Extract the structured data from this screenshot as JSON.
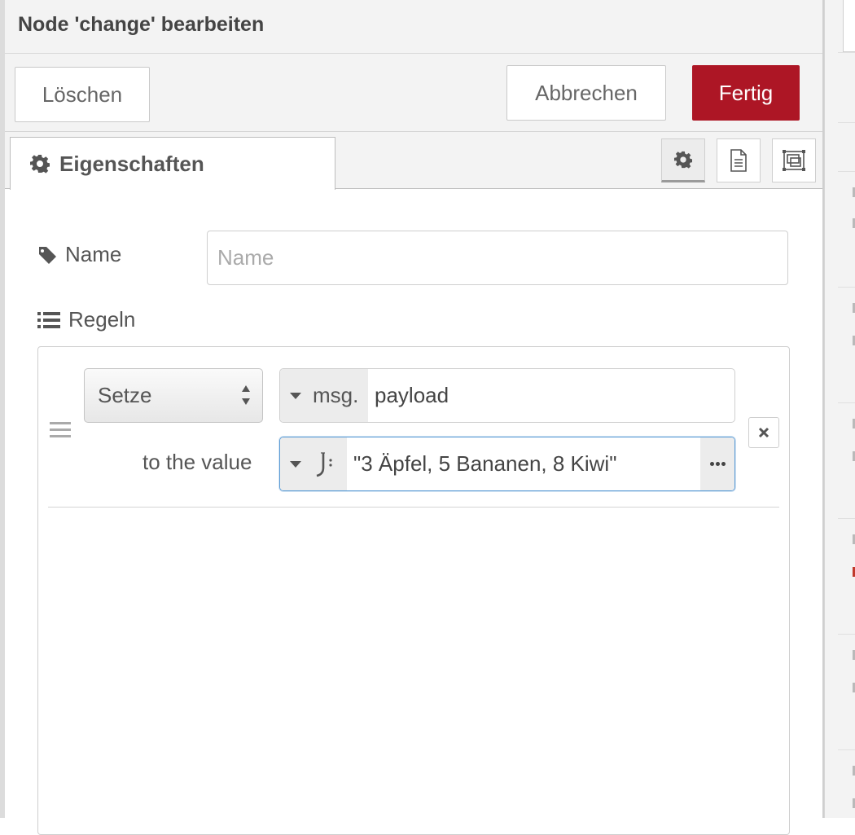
{
  "header": {
    "title": "Node 'change' bearbeiten"
  },
  "toolbar": {
    "delete_label": "Löschen",
    "cancel_label": "Abbrechen",
    "done_label": "Fertig"
  },
  "tabs": {
    "properties_label": "Eigenschaften",
    "side_buttons": [
      "gear-icon",
      "document-icon",
      "frame-icon"
    ]
  },
  "form": {
    "name_label": "Name",
    "name_placeholder": "Name",
    "name_value": "",
    "rules_label": "Regeln"
  },
  "rule": {
    "action": "Setze",
    "property_prefix": "msg.",
    "property": "payload",
    "to_value_label": "to the value",
    "value_type_icon": "jsonata-icon",
    "value": "\"3 Äpfel, 5 Bananen, 8 Kiwi\""
  },
  "colors": {
    "primary_button": "#ad1625",
    "focus_border": "#5b9bd5",
    "header_bg": "#f3f3f3"
  }
}
